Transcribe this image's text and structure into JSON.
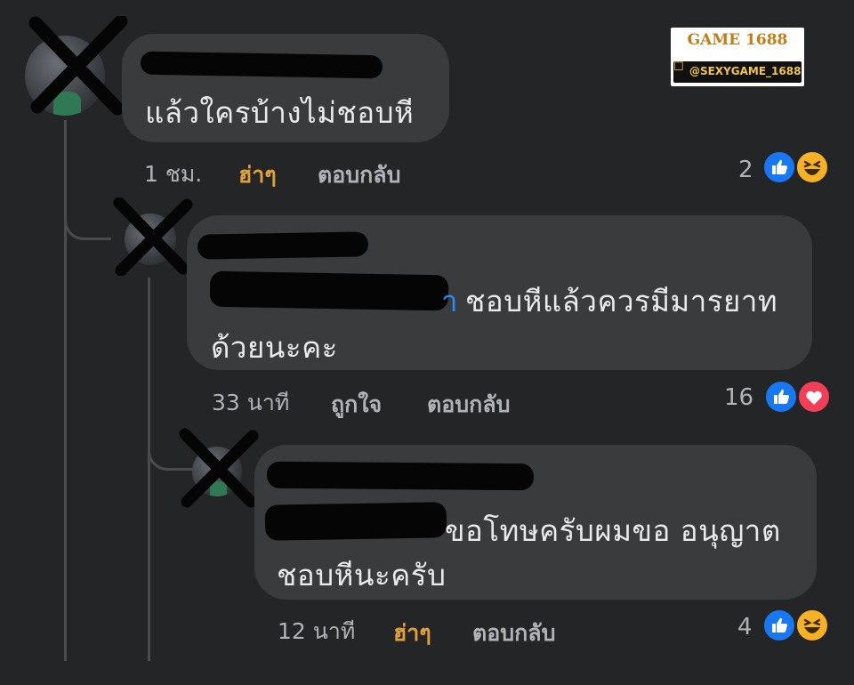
{
  "watermark": {
    "brand": "GAME 1688",
    "handle": "@SEXYGAME_1688"
  },
  "comments": [
    {
      "text_lines": [
        "แล้วใครบ้างไม่ชอบหี"
      ],
      "time": "1 ชม.",
      "reaction_label": "ฮ่าๆ",
      "reply_label": "ตอบกลับ",
      "reaction_count": "2",
      "reaction_icons": [
        "like-icon",
        "haha-icon"
      ]
    },
    {
      "text_lines": [
        "ชอบหีแล้วควรมีมารยาท",
        "ด้วยนะคะ"
      ],
      "time": "33 นาที",
      "reaction_label": "ถูกใจ",
      "reply_label": "ตอบกลับ",
      "reaction_count": "16",
      "reaction_icons": [
        "like-icon",
        "love-icon"
      ]
    },
    {
      "text_lines": [
        "ขอโทษครับผมขอ อนุญาต",
        "ชอบหีนะครับ"
      ],
      "time": "12 นาที",
      "reaction_label": "ฮ่าๆ",
      "reply_label": "ตอบกลับ",
      "reaction_count": "4",
      "reaction_icons": [
        "like-icon",
        "haha-icon"
      ]
    }
  ],
  "colors": {
    "background": "#242526",
    "bubble": "#3a3b3c",
    "haha_label": "#e0a13a",
    "like_blue": "#1877f2",
    "love_red": "#f33e58",
    "haha_yellow": "#f7b125"
  }
}
